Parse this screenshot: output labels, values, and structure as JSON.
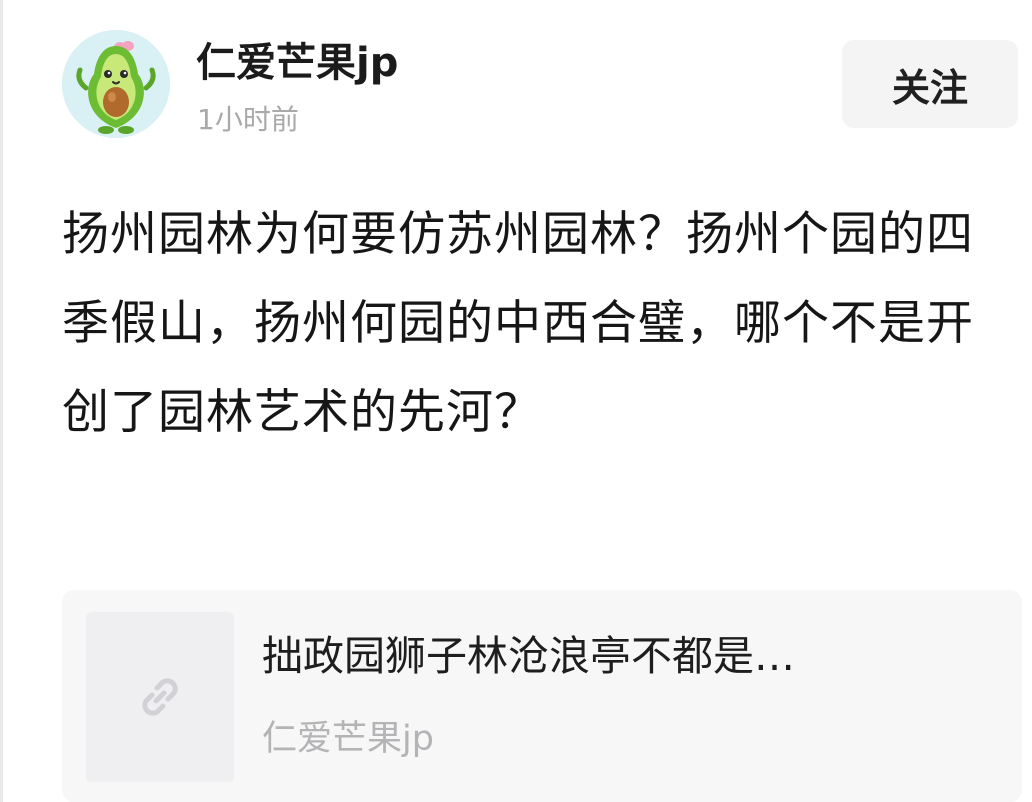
{
  "post": {
    "author": {
      "name": "仁爱芒果jp",
      "avatar_icon": "avocado-avatar-icon"
    },
    "time": "1小时前",
    "follow_label": "关注",
    "body": "扬州园林为何要仿苏州园林？扬州个园的四季假山，扬州何园的中西合璧，哪个不是开创了园林艺术的先河？"
  },
  "link_card": {
    "thumbnail_icon": "link-icon",
    "title": "拙政园狮子林沧浪亭不都是…",
    "source": "仁爱芒果jp"
  },
  "colors": {
    "avatar_background": "#d9f0f5",
    "avocado_green": "#7ecb3a",
    "pit_brown": "#b06a2c",
    "follow_button_bg": "#f4f4f5",
    "card_bg": "#f7f7f8",
    "muted_text": "#a9a9a9"
  }
}
